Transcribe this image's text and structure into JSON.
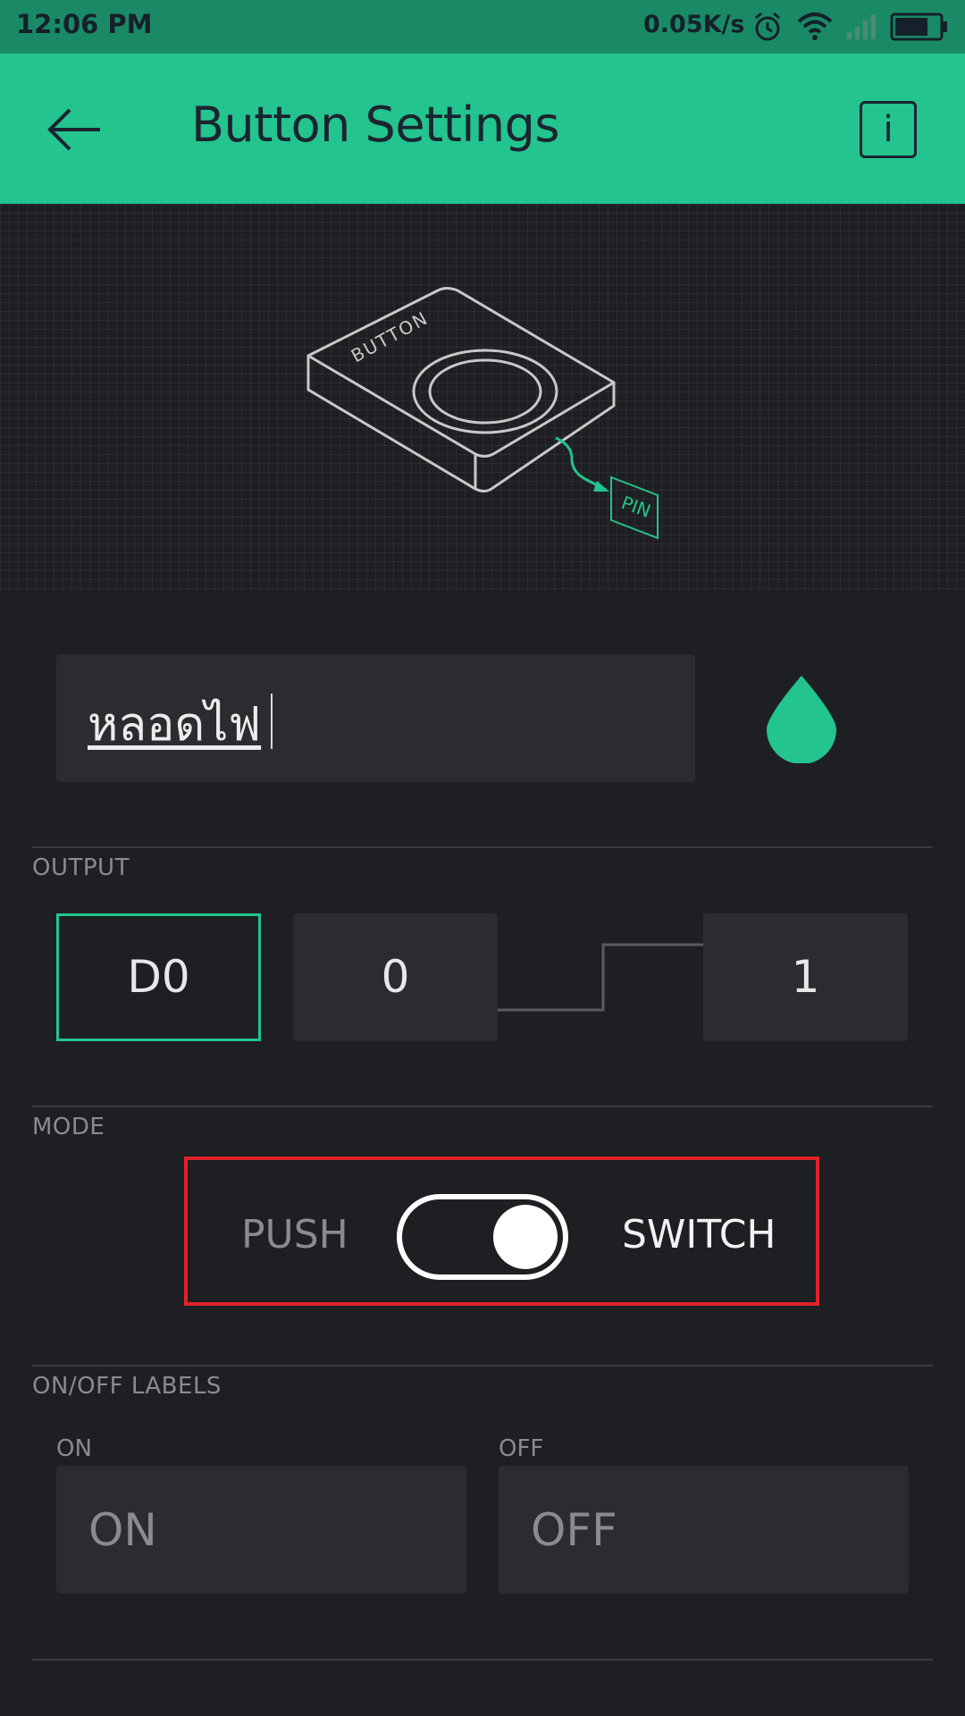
{
  "status_bar": {
    "time": "12:06 PM",
    "net_speed": "0.05K/s",
    "icons": [
      "alarm-icon",
      "wifi-icon",
      "signal-icon",
      "battery-icon"
    ]
  },
  "app_bar": {
    "back_icon": "arrow-left-icon",
    "title": "Button Settings",
    "info_label": "i"
  },
  "hero": {
    "device_label": "BUTTON",
    "pin_label": "PIN"
  },
  "widget": {
    "name": "หลอดไฟ",
    "color_icon": "color-drop-icon",
    "accent_color": "#23c48e"
  },
  "output": {
    "section_label": "OUTPUT",
    "pin": "D0",
    "low_value": "0",
    "high_value": "1"
  },
  "mode": {
    "section_label": "MODE",
    "push_label": "PUSH",
    "switch_label": "SWITCH",
    "selected": "SWITCH"
  },
  "labels": {
    "section_label": "ON/OFF LABELS",
    "on_caption": "ON",
    "on_placeholder": "ON",
    "off_caption": "OFF",
    "off_placeholder": "OFF"
  }
}
